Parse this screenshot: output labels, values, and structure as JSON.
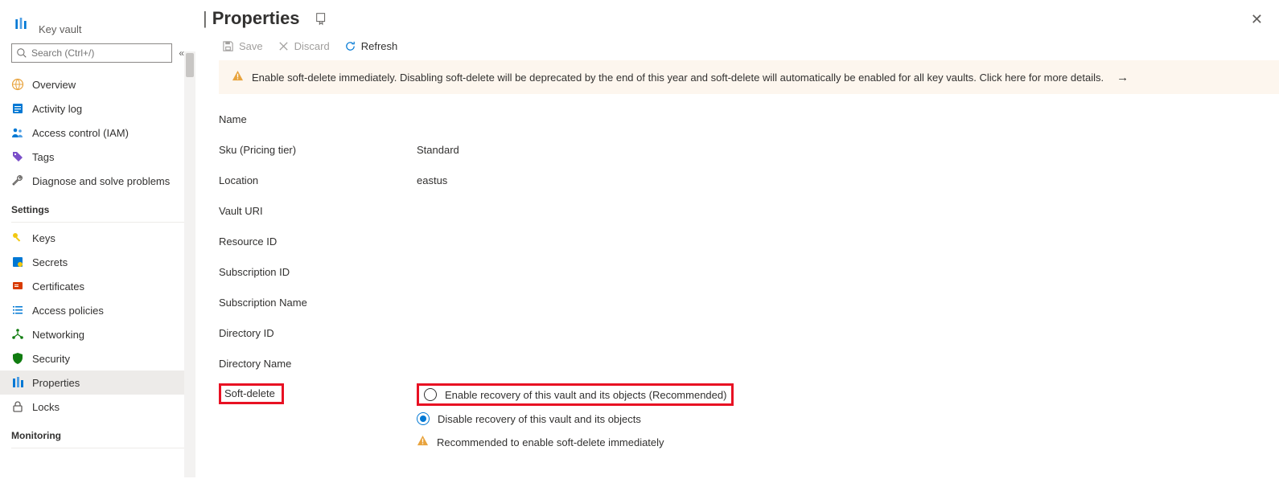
{
  "sidebar": {
    "resource_type": "Key vault",
    "search_placeholder": "Search (Ctrl+/)",
    "top": [
      {
        "name": "overview",
        "label": "Overview"
      },
      {
        "name": "activity-log",
        "label": "Activity log"
      },
      {
        "name": "access-control",
        "label": "Access control (IAM)"
      },
      {
        "name": "tags",
        "label": "Tags"
      },
      {
        "name": "diagnose",
        "label": "Diagnose and solve problems"
      }
    ],
    "section_settings": "Settings",
    "settings": [
      {
        "name": "keys",
        "label": "Keys"
      },
      {
        "name": "secrets",
        "label": "Secrets"
      },
      {
        "name": "certificates",
        "label": "Certificates"
      },
      {
        "name": "access-policies",
        "label": "Access policies"
      },
      {
        "name": "networking",
        "label": "Networking"
      },
      {
        "name": "security",
        "label": "Security"
      },
      {
        "name": "properties",
        "label": "Properties",
        "selected": true
      },
      {
        "name": "locks",
        "label": "Locks"
      }
    ],
    "section_monitoring": "Monitoring"
  },
  "header": {
    "title": "Properties"
  },
  "toolbar": {
    "save": "Save",
    "discard": "Discard",
    "refresh": "Refresh"
  },
  "banner": {
    "text": "Enable soft-delete immediately. Disabling soft-delete will be deprecated by the end of this year and soft-delete will automatically be enabled for all key vaults. Click here for more details."
  },
  "properties": {
    "name_label": "Name",
    "name_value": "",
    "sku_label": "Sku (Pricing tier)",
    "sku_value": "Standard",
    "location_label": "Location",
    "location_value": "eastus",
    "vault_uri_label": "Vault URI",
    "vault_uri_value": "",
    "resource_id_label": "Resource ID",
    "resource_id_value": "",
    "subscription_id_label": "Subscription ID",
    "subscription_id_value": "",
    "subscription_name_label": "Subscription Name",
    "subscription_name_value": "",
    "directory_id_label": "Directory ID",
    "directory_id_value": "",
    "directory_name_label": "Directory Name",
    "directory_name_value": "",
    "softdelete_label": "Soft-delete",
    "softdelete_enable": "Enable recovery of this vault and its objects (Recommended)",
    "softdelete_disable": "Disable recovery of this vault and its objects",
    "softdelete_recommend": "Recommended to enable soft-delete immediately"
  }
}
